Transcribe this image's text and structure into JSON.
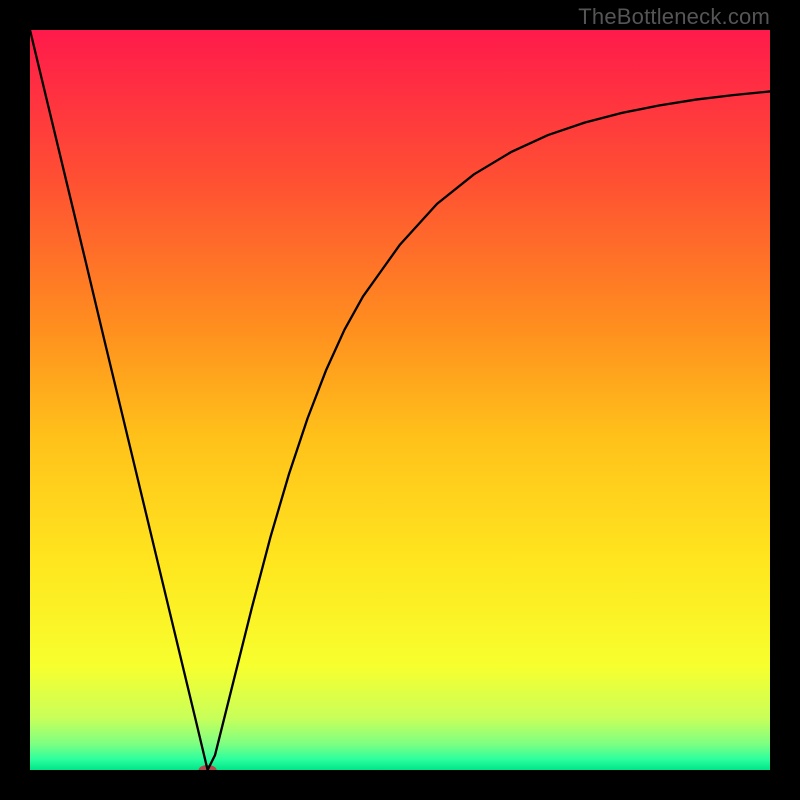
{
  "watermark": "TheBottleneck.com",
  "chart_data": {
    "type": "line",
    "title": "",
    "xlabel": "",
    "ylabel": "",
    "xlim": [
      0,
      100
    ],
    "ylim": [
      0,
      100
    ],
    "grid": false,
    "legend": false,
    "background_gradient": {
      "stops": [
        {
          "offset": 0.0,
          "color": "#ff1a4b"
        },
        {
          "offset": 0.2,
          "color": "#ff4f33"
        },
        {
          "offset": 0.4,
          "color": "#ff8e1f"
        },
        {
          "offset": 0.55,
          "color": "#ffc11a"
        },
        {
          "offset": 0.72,
          "color": "#ffe61f"
        },
        {
          "offset": 0.86,
          "color": "#f7ff2e"
        },
        {
          "offset": 0.93,
          "color": "#c8ff5a"
        },
        {
          "offset": 0.965,
          "color": "#7dff82"
        },
        {
          "offset": 0.985,
          "color": "#2eff9e"
        },
        {
          "offset": 1.0,
          "color": "#00e58a"
        }
      ]
    },
    "series": [
      {
        "name": "bottleneck-curve",
        "x": [
          0.0,
          2.5,
          5.0,
          7.5,
          10.0,
          12.5,
          15.0,
          17.5,
          20.0,
          22.5,
          24.0,
          25.0,
          27.5,
          30.0,
          32.5,
          35.0,
          37.5,
          40.0,
          42.5,
          45.0,
          50.0,
          55.0,
          60.0,
          65.0,
          70.0,
          75.0,
          80.0,
          85.0,
          90.0,
          95.0,
          100.0
        ],
        "y": [
          100.0,
          89.6,
          79.2,
          68.8,
          58.3,
          47.9,
          37.5,
          27.1,
          16.7,
          6.3,
          0.0,
          2.0,
          12.0,
          22.0,
          31.5,
          40.0,
          47.5,
          54.0,
          59.5,
          64.0,
          71.0,
          76.5,
          80.5,
          83.5,
          85.8,
          87.5,
          88.8,
          89.8,
          90.6,
          91.2,
          91.7
        ]
      }
    ],
    "markers": [
      {
        "name": "min-point",
        "x": 24.0,
        "y": 0.0,
        "color": "#b24a4a",
        "rx": 9,
        "ry": 5
      }
    ]
  }
}
